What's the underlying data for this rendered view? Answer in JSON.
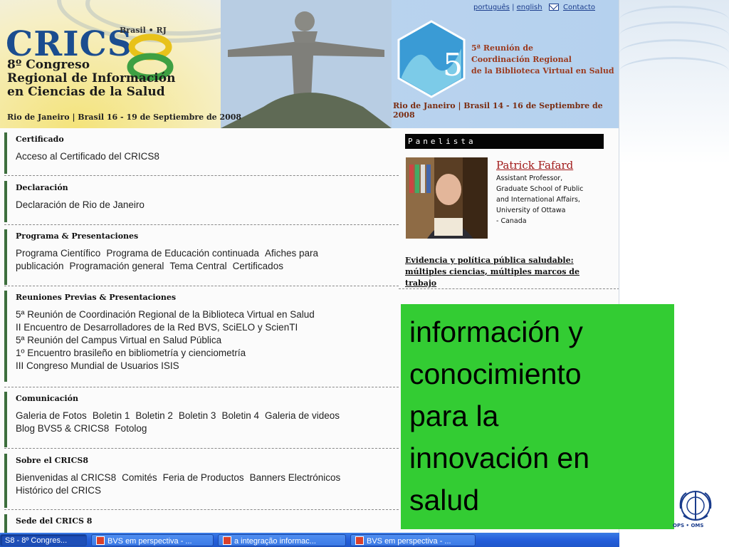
{
  "banner": {
    "crics": "CRICS",
    "brasil_rj": "Brasil • RJ",
    "congress_name": "8º Congreso\nRegional de Información\nen Ciencias de la Salud",
    "congress_dates": "Rio de Janeiro | Brasil 16 - 19 de Septiembre de 2008",
    "links": {
      "pt": "português",
      "en": "english",
      "contact": "Contacto"
    },
    "reunion_number": "5",
    "reunion_text": "5ª Reunión de\nCoordinación Regional\nde la Biblioteca Virtual en Salud",
    "reunion_dates": "Rio de Janeiro | Brasil 14 - 16 de Septiembre de 2008"
  },
  "sections": [
    {
      "title": "Certificado",
      "items": [
        "Acceso al Certificado del CRICS8"
      ]
    },
    {
      "title": "Declaración",
      "items": [
        "Declaración de Rio de Janeiro"
      ]
    },
    {
      "title": "Programa & Presentaciones",
      "items": [
        "Programa Científico",
        "Programa de Educación continuada",
        "Afiches para publicación",
        "Programación general",
        "Tema Central",
        "Certificados"
      ]
    },
    {
      "title": "Reuniones Previas & Presentaciones",
      "items": [
        "5ª Reunión de Coordinación Regional de la Biblioteca Virtual en Salud",
        "II Encuentro de Desarrolladores de la Red BVS, SciELO y ScienTI",
        "5ª Reunión del Campus Virtual en Salud Pública",
        "1º Encuentro brasileño en bibliometría y cienciometría",
        "III Congreso Mundial de Usuarios ISIS"
      ]
    },
    {
      "title": "Comunicación",
      "items": [
        "Galeria de Fotos",
        "Boletin 1",
        "Boletin 2",
        "Boletin 3",
        "Boletin 4",
        "Galeria de videos",
        "Blog BVS5 & CRICS8",
        "Fotolog"
      ]
    },
    {
      "title": "Sobre el CRICS8",
      "items": [
        "Bienvenidas al CRICS8",
        "Comités",
        "Feria de Productos",
        "Banners Electrónicos",
        "Histórico del CRICS"
      ]
    },
    {
      "title": "Sede del CRICS 8",
      "items": []
    }
  ],
  "panelista": {
    "header": "Panelista",
    "name": "Patrick Fafard",
    "desc": "Assistant Professor,\nGraduate School of Public\nand International Affairs,\nUniversity of Ottawa\n - Canada",
    "talk": "Evidencia y política pública saludable: múltiples ciencias, múltiples marcos de trabajo"
  },
  "green_text": "información y\nconocimiento\npara la\ninnovación en\nsalud",
  "ops_label": "OPS • OMS",
  "taskbar": [
    {
      "label": "S8 - 8º Congres...",
      "active": true
    },
    {
      "label": "BVS em perspectiva - ...",
      "active": false
    },
    {
      "label": "a integração informac...",
      "active": false
    },
    {
      "label": "BVS em perspectiva - ...",
      "active": false
    }
  ],
  "colors": {
    "green_box": "#33cc33",
    "section_bar": "#3d6e3d",
    "link": "#1a3c8c",
    "panelist_name": "#a01818"
  }
}
